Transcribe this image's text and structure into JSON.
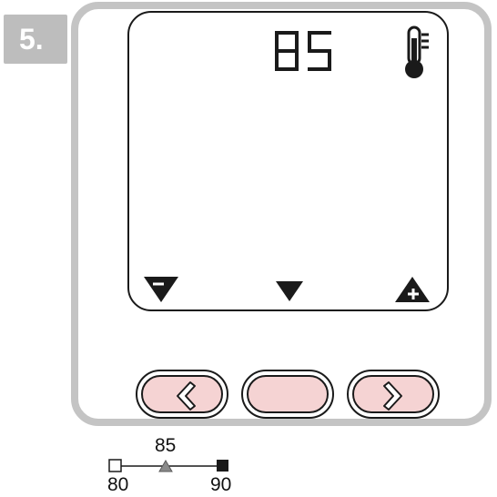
{
  "step": {
    "label": "5."
  },
  "display": {
    "value": "85",
    "icon": "thermometer-icon"
  },
  "soft_keys": {
    "left": "triangle-down-minus-icon",
    "middle": "triangle-down-icon",
    "right": "triangle-up-plus-icon"
  },
  "buttons": {
    "left": "chevron-left-icon",
    "middle": "blank",
    "right": "chevron-right-icon",
    "fill_color": "#f5d3d3"
  },
  "range_scale": {
    "min": "80",
    "current": "85",
    "max": "90",
    "current_fraction": 0.5
  }
}
